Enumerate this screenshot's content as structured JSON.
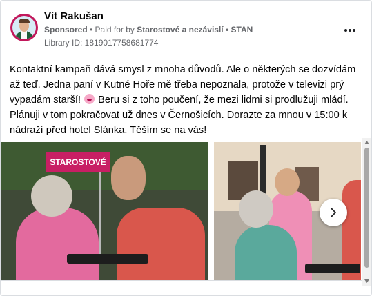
{
  "post": {
    "author": "Vít Rakušan",
    "sponsored_label": "Sponsored",
    "paid_for_prefix": " • Paid for by ",
    "paid_for_by": "Starostové a nezávislí • STAN",
    "library_id": "Library ID: 1819017758681774",
    "text_part1": "Kontaktní kampaň dává smysl z mnoha důvodů. Ale o některých se dozvídám až teď. Jedna paní v Kutné Hoře mě třeba nepoznala, protože v televizi prý vypadám starší!",
    "text_part2": " Beru si z toho poučení, že mezi lidmi si prodlužuji mládí. Plánuji v tom pokračovat už dnes v Černošicích. Dorazte za mnou v 15:00 k nádraží před hotel Slánka. Těším se na vás!"
  },
  "carousel": {
    "banner_text": "STAROSTOVÉ",
    "next_icon": "chevron-right-icon"
  },
  "icons": {
    "more": "more-options-icon",
    "emoji": "grinning-face-emoji-icon"
  },
  "colors": {
    "brand": "#c81f64",
    "text": "#050505",
    "meta": "#65676b"
  }
}
